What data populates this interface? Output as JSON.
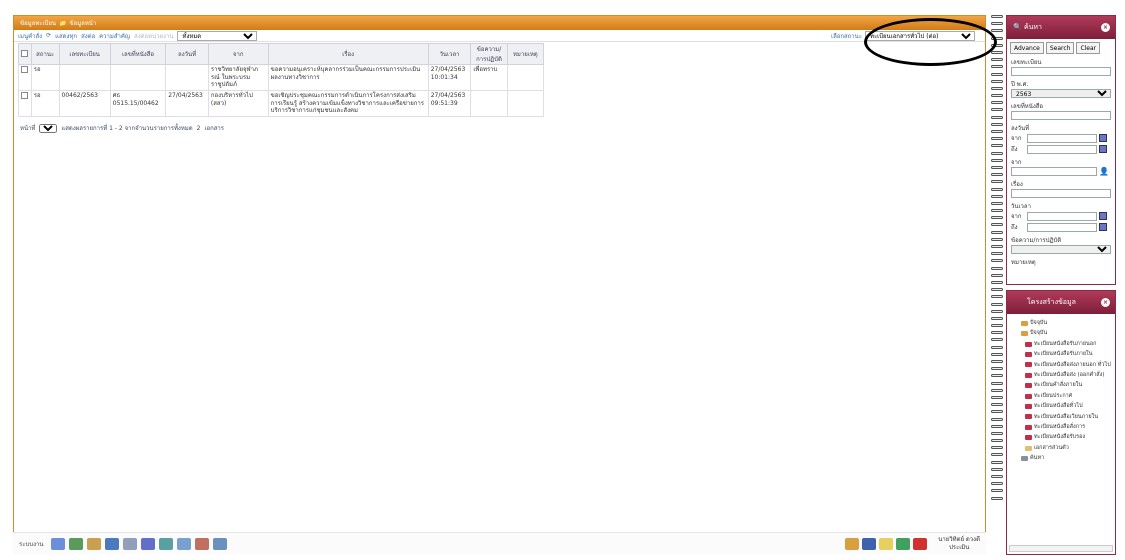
{
  "title_bar": {
    "left": "ข้อมูลทะเบียน",
    "right": "ข้อมูลหน้า"
  },
  "toolbar": {
    "menu": "เมนูคำสั่ง",
    "links": [
      "แสดงทุก",
      "ส่งต่อ",
      "ความสำคัญ"
    ],
    "muted": "ส่งต่อหน่วยงาน",
    "scope_value": "ทั้งหมด",
    "status_label": "เลือกสถานะ",
    "status_value": "ทะเบียนเอกสารทั่วไป (ต่อ)"
  },
  "table": {
    "columns": [
      "สถานะ",
      "เลขทะเบียน",
      "เลขที่หนังสือ",
      "ลงวันที่",
      "จาก",
      "เรื่อง",
      "วันเวลา",
      "ข้อความ/การปฏิบัติ",
      "หมายเหตุ"
    ],
    "rows": [
      {
        "status": "รอ",
        "reg_no": "",
        "doc_no": "",
        "date": "",
        "from": "ราชวิทยาลัยจุฬาภรณ์ ในพระบรมราชูปถัมภ์",
        "subject": "ขอความอนุเคราะห์บุคลากรร่วมเป็นคณะกรรมการประเมินผลงานทางวิชาการ",
        "datetime": "27/04/2563 10:01:34",
        "action": "เพื่อทราบ",
        "remark": ""
      },
      {
        "status": "รอ",
        "reg_no": "00462/2563",
        "doc_no": "ศธ 0515.15/00462",
        "date": "27/04/2563",
        "from": "กองบริหารทั่วไป (สสว)",
        "subject": "ขอเชิญประชุมคณะกรรมการดำเนินการโครงการส่งเสริมการเรียนรู้ สร้างความเข้มแข็งทางวิชาการและเครือข่ายการบริการวิชาการแก่ชุมชนและสังคม",
        "datetime": "27/04/2563 09:51:39",
        "action": "",
        "remark": ""
      }
    ]
  },
  "pager": {
    "label": "หน้าที่",
    "page": "1",
    "summary": "แสดงผลรายการที่ 1 - 2 จากจำนวนรายการทั้งหมด",
    "total": "2",
    "unit": "เอกสาร"
  },
  "taskbar": {
    "start_label": "ระบบงาน",
    "user_name": "นายวิทิตย์ ดวงดี",
    "user_role": "ประเมิน"
  },
  "search_panel": {
    "title": "ค้นหา",
    "btn_advance": "Advance",
    "btn_search": "Search",
    "btn_clear": "Clear",
    "f_regno": "เลขทะเบียน",
    "f_year": "ปี พ.ศ.",
    "year_value": "2563",
    "f_docno": "เลขที่หนังสือ",
    "f_date": "ลงวันที่",
    "from_short": "จาก",
    "to_short": "ถึง",
    "f_from": "จาก",
    "f_subject": "เรื่อง",
    "f_datetime": "วันเวลา",
    "f_action": "ข้อความ/การปฏิบัติ",
    "f_remark": "หมายเหตุ"
  },
  "tree_panel": {
    "title": "โครงสร้างข้อมูล",
    "items": [
      "ปัจจุบัน",
      "ปัจจุบัน",
      "ทะเบียนหนังสือรับภายนอก",
      "ทะเบียนหนังสือรับภายใน",
      "ทะเบียนหนังสือส่งภายนอก ทั่วไป",
      "ทะเบียนหนังสือส่ง (ออกคำสั่ง)",
      "ทะเบียนคำสั่งภายใน",
      "ทะเบียนประกาศ",
      "ทะเบียนหนังสือทั่วไป",
      "ทะเบียนหนังสือเวียนภายใน",
      "ทะเบียนหนังสือสั่งการ",
      "ทะเบียนหนังสือรับรอง",
      "เอกสารส่วนตัว",
      "ค้นหา"
    ]
  },
  "colors": {
    "title_orange": "#e08a22",
    "panel_maroon": "#8a2a45",
    "link_blue": "#3a6fb0"
  }
}
